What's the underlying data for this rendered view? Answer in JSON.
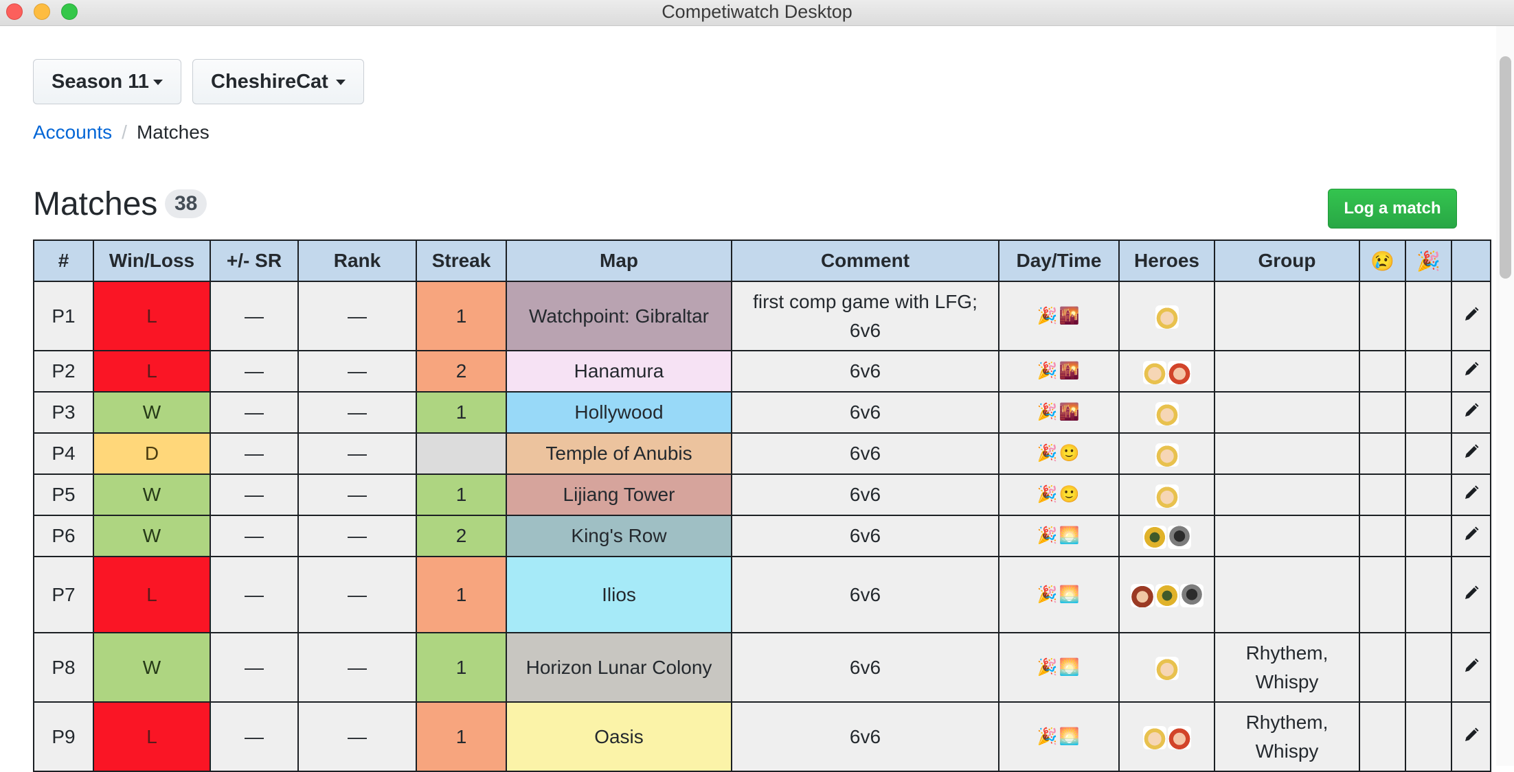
{
  "window": {
    "title": "Competiwatch Desktop"
  },
  "selectors": {
    "season": "Season 11",
    "account": "CheshireCat"
  },
  "breadcrumb": {
    "accounts": "Accounts",
    "separator": "/",
    "current": "Matches"
  },
  "page": {
    "heading": "Matches",
    "count": "38",
    "log_button": "Log a match"
  },
  "table": {
    "headers": [
      "#",
      "Win/Loss",
      "+/- SR",
      "Rank",
      "Streak",
      "Map",
      "Comment",
      "Day/Time",
      "Heroes",
      "Group",
      "😢",
      "🎉",
      ""
    ],
    "rows": [
      {
        "num": "P1",
        "result": "L",
        "sr": "—",
        "rank": "—",
        "streak": "1",
        "map": "Watchpoint: Gibraltar",
        "map_color": "#b9a3b1",
        "comment": "first comp game with LFG; 6v6",
        "daytime": "🎉🌇",
        "heroes": [
          "mercy"
        ],
        "group": "",
        "sad": "",
        "party": ""
      },
      {
        "num": "P2",
        "result": "L",
        "sr": "—",
        "rank": "—",
        "streak": "2",
        "map": "Hanamura",
        "map_color": "#f6e2f4",
        "comment": "6v6",
        "daytime": "🎉🌇",
        "heroes": [
          "mercy",
          "tracer"
        ],
        "group": "",
        "sad": "",
        "party": ""
      },
      {
        "num": "P3",
        "result": "W",
        "sr": "—",
        "rank": "—",
        "streak": "1",
        "map": "Hollywood",
        "map_color": "#98d9f8",
        "comment": "6v6",
        "daytime": "🎉🌇",
        "heroes": [
          "mercy"
        ],
        "group": "",
        "sad": "",
        "party": ""
      },
      {
        "num": "P4",
        "result": "D",
        "sr": "—",
        "rank": "—",
        "streak": "",
        "map": "Temple of Anubis",
        "map_color": "#ecc39e",
        "comment": "6v6",
        "daytime": "🎉🙂",
        "heroes": [
          "mercy"
        ],
        "group": "",
        "sad": "",
        "party": ""
      },
      {
        "num": "P5",
        "result": "W",
        "sr": "—",
        "rank": "—",
        "streak": "1",
        "map": "Lijiang Tower",
        "map_color": "#d6a49c",
        "comment": "6v6",
        "daytime": "🎉🙂",
        "heroes": [
          "mercy"
        ],
        "group": "",
        "sad": "",
        "party": ""
      },
      {
        "num": "P6",
        "result": "W",
        "sr": "—",
        "rank": "—",
        "streak": "2",
        "map": "King's Row",
        "map_color": "#9fbfc4",
        "comment": "6v6",
        "daytime": "🎉🌅",
        "heroes": [
          "junkrat",
          "reaper"
        ],
        "group": "",
        "sad": "",
        "party": ""
      },
      {
        "num": "P7",
        "result": "L",
        "sr": "—",
        "rank": "—",
        "streak": "1",
        "map": "Ilios",
        "map_color": "#a6eaf8",
        "comment": "6v6",
        "daytime": "🎉🌅",
        "heroes": [
          "brigitte",
          "junkrat",
          "reaper"
        ],
        "group": "",
        "sad": "",
        "party": ""
      },
      {
        "num": "P8",
        "result": "W",
        "sr": "—",
        "rank": "—",
        "streak": "1",
        "map": "Horizon Lunar Colony",
        "map_color": "#c8c6c1",
        "comment": "6v6",
        "daytime": "🎉🌅",
        "heroes": [
          "mercy"
        ],
        "group": "Rhythem, Whispy",
        "sad": "",
        "party": ""
      },
      {
        "num": "P9",
        "result": "L",
        "sr": "—",
        "rank": "—",
        "streak": "1",
        "map": "Oasis",
        "map_color": "#fbf3a8",
        "comment": "6v6",
        "daytime": "🎉🌅",
        "heroes": [
          "mercy",
          "tracer"
        ],
        "group": "Rhythem, Whispy",
        "sad": "",
        "party": ""
      }
    ]
  }
}
